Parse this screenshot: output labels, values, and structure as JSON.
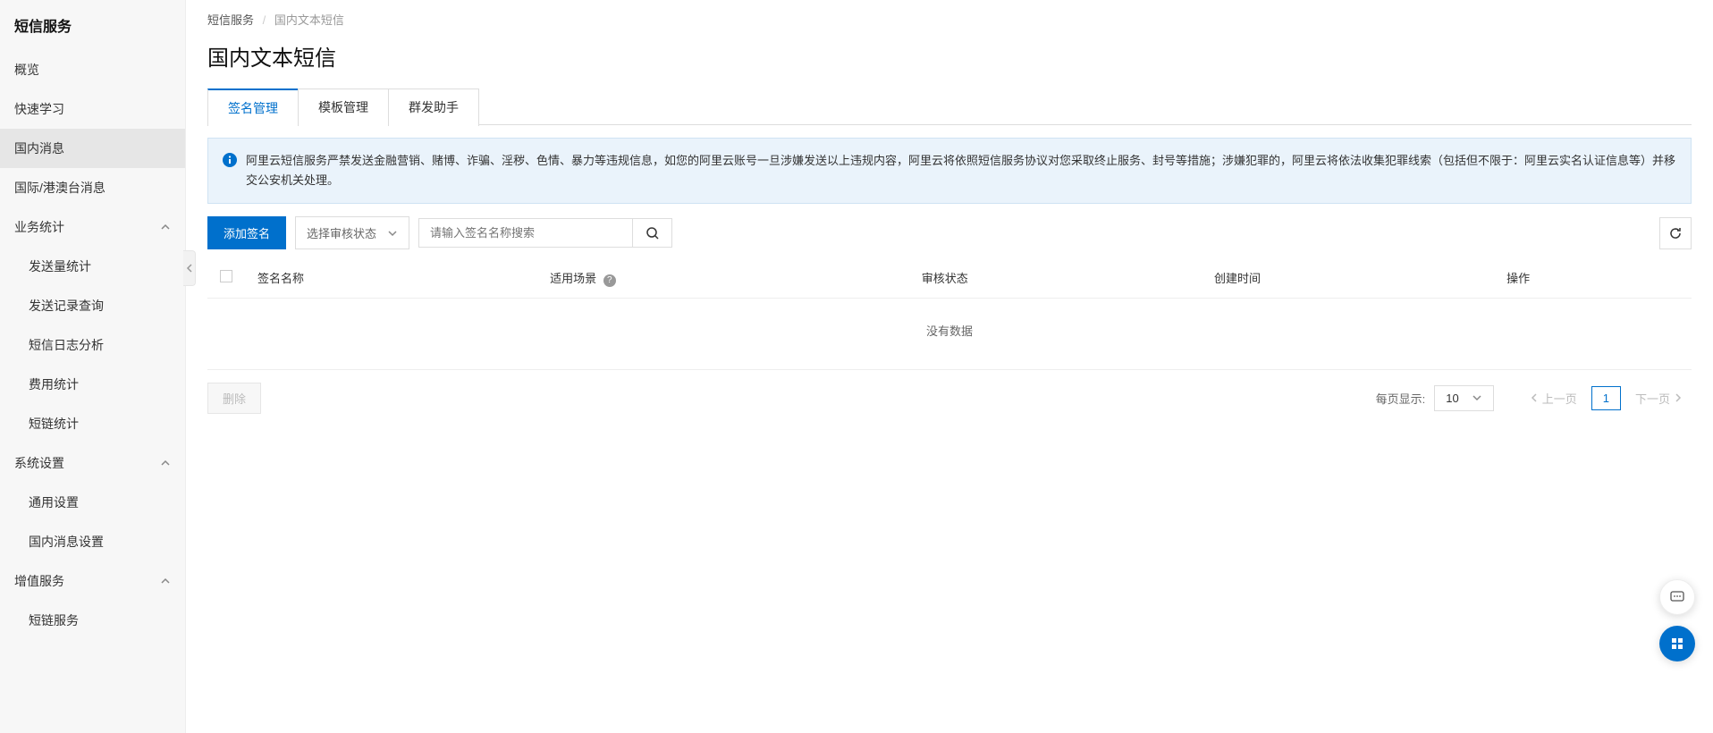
{
  "sidebar": {
    "title": "短信服务",
    "items": [
      {
        "label": "概览"
      },
      {
        "label": "快速学习"
      },
      {
        "label": "国内消息",
        "active": true
      },
      {
        "label": "国际/港澳台消息"
      }
    ],
    "groups": [
      {
        "title": "业务统计",
        "items": [
          {
            "label": "发送量统计"
          },
          {
            "label": "发送记录查询"
          },
          {
            "label": "短信日志分析"
          },
          {
            "label": "费用统计"
          },
          {
            "label": "短链统计"
          }
        ]
      },
      {
        "title": "系统设置",
        "items": [
          {
            "label": "通用设置"
          },
          {
            "label": "国内消息设置"
          }
        ]
      },
      {
        "title": "增值服务",
        "items": [
          {
            "label": "短链服务"
          }
        ]
      }
    ]
  },
  "breadcrumb": {
    "root": "短信服务",
    "current": "国内文本短信"
  },
  "page_title": "国内文本短信",
  "tabs": [
    {
      "label": "签名管理",
      "active": true
    },
    {
      "label": "模板管理"
    },
    {
      "label": "群发助手"
    }
  ],
  "banner": {
    "text": "阿里云短信服务严禁发送金融营销、赌博、诈骗、淫秽、色情、暴力等违规信息，如您的阿里云账号一旦涉嫌发送以上违规内容，阿里云将依照短信服务协议对您采取终止服务、封号等措施；涉嫌犯罪的，阿里云将依法收集犯罪线索（包括但不限于：阿里云实名认证信息等）并移交公安机关处理。"
  },
  "toolbar": {
    "add_label": "添加签名",
    "filter_placeholder": "选择审核状态",
    "search_placeholder": "请输入签名名称搜索"
  },
  "table": {
    "columns": [
      "签名名称",
      "适用场景",
      "审核状态",
      "创建时间",
      "操作"
    ],
    "empty": "没有数据"
  },
  "footer": {
    "delete_label": "删除",
    "page_size_label": "每页显示:",
    "page_size_value": "10",
    "prev_label": "上一页",
    "current_page": "1",
    "next_label": "下一页"
  }
}
